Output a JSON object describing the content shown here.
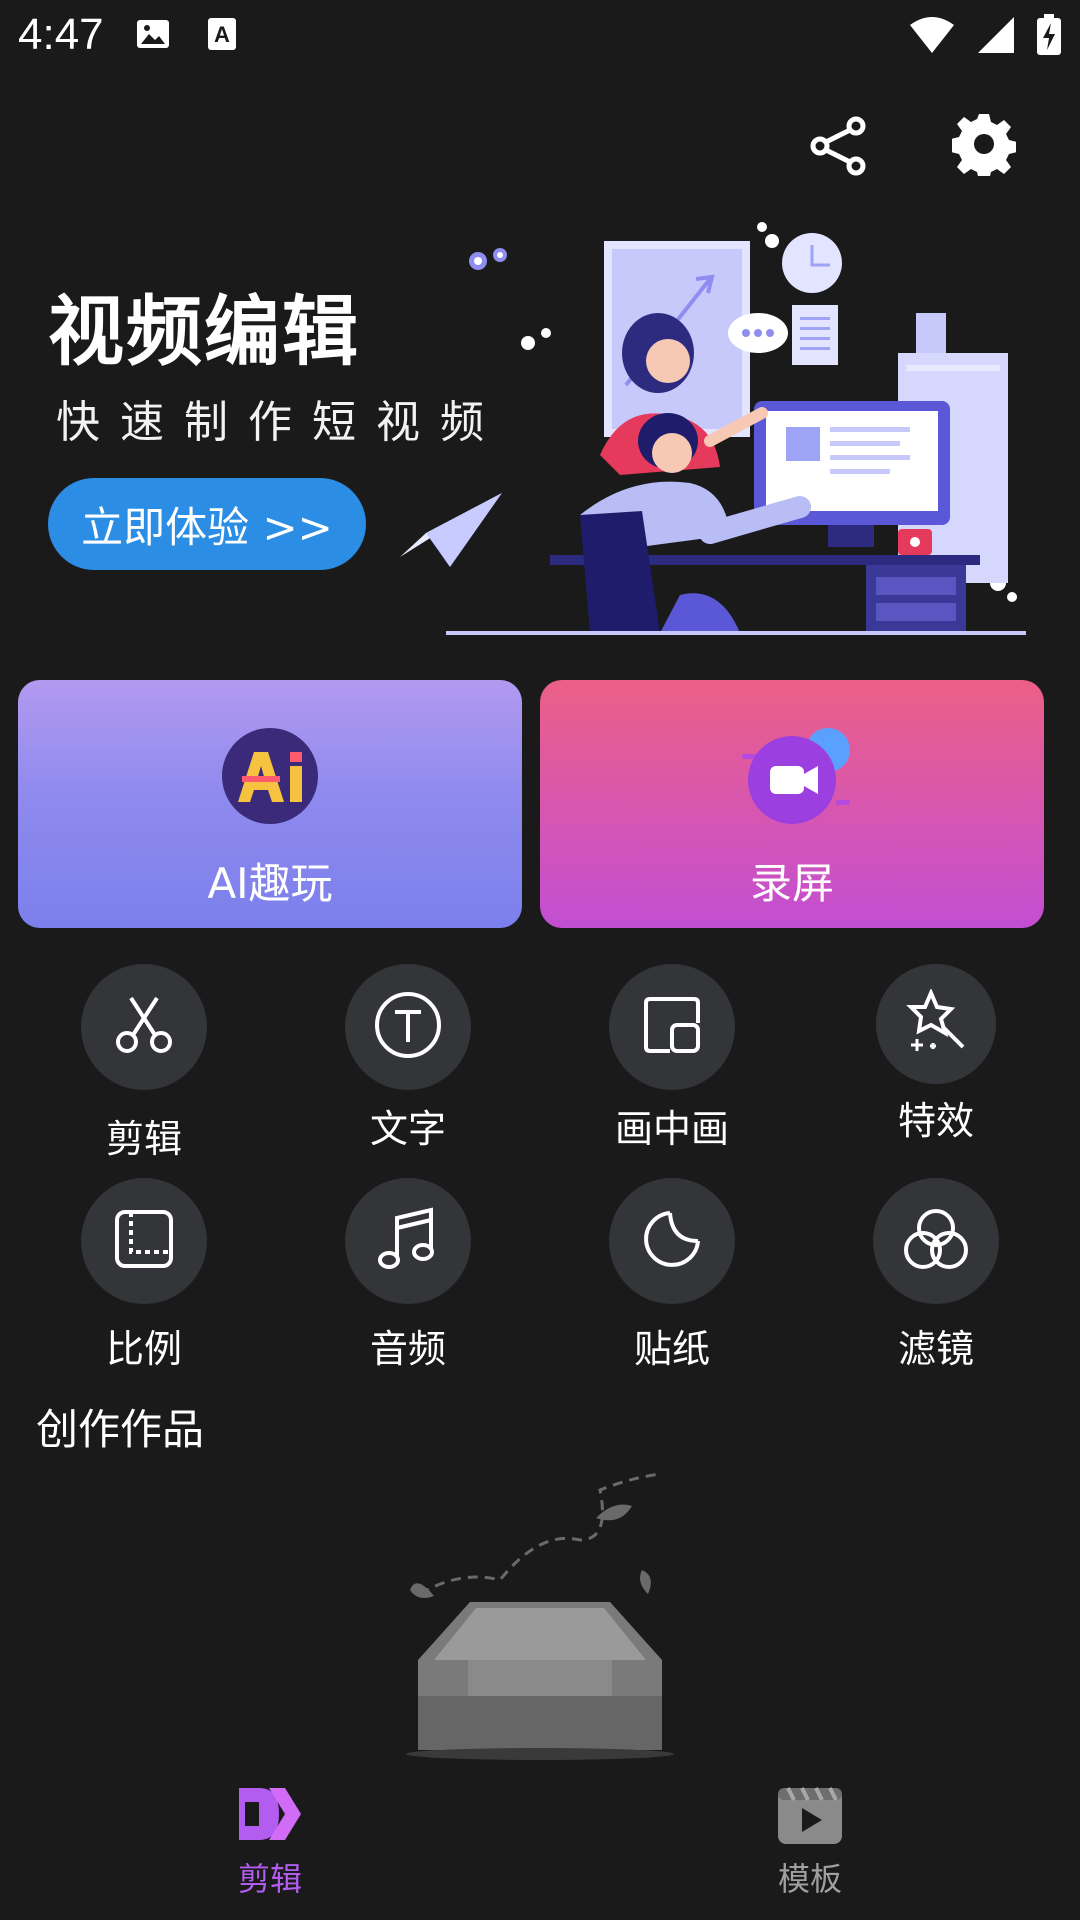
{
  "status_bar": {
    "time": "4:47",
    "left_icons": [
      "image-icon",
      "keyboard-a-icon"
    ],
    "right_icons": [
      "wifi-icon",
      "signal-icon",
      "battery-charging-icon"
    ]
  },
  "top_actions": {
    "share_icon": "share-icon",
    "settings_icon": "gear-icon"
  },
  "hero": {
    "title": "视频编辑",
    "subtitle": "快速制作短视频",
    "cta_label": "立即体验 >>"
  },
  "cards": {
    "ai": {
      "label": "AI趣玩",
      "icon": "ai-icon"
    },
    "record": {
      "label": "录屏",
      "icon": "camera-icon"
    }
  },
  "tools": [
    {
      "label": "剪辑",
      "icon": "scissors-icon"
    },
    {
      "label": "文字",
      "icon": "text-icon"
    },
    {
      "label": "画中画",
      "icon": "pip-icon"
    },
    {
      "label": "特效",
      "icon": "sparkle-icon"
    },
    {
      "label": "比例",
      "icon": "aspect-ratio-icon"
    },
    {
      "label": "音频",
      "icon": "music-note-icon"
    },
    {
      "label": "贴纸",
      "icon": "sticker-icon"
    },
    {
      "label": "滤镜",
      "icon": "filter-icon"
    }
  ],
  "works": {
    "section_title": "创作作品",
    "empty_icon": "empty-tray-icon"
  },
  "bottom_nav": [
    {
      "label": "剪辑",
      "icon": "editor-logo-icon",
      "active": true
    },
    {
      "label": "模板",
      "icon": "template-icon",
      "active": false
    }
  ],
  "colors": {
    "background": "#1a1a1a",
    "cta": "#2b8de4",
    "nav_active": "#b25cf0",
    "nav_inactive": "#a0a0a0",
    "tool_circle": "#333539"
  }
}
